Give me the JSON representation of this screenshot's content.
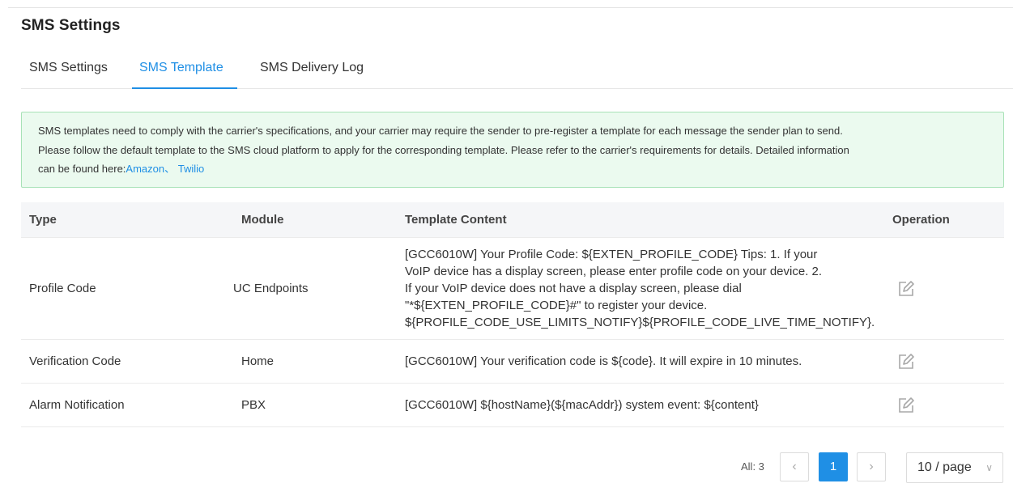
{
  "page": {
    "title": "SMS Settings",
    "tabs": [
      {
        "label": "SMS Settings",
        "active": false
      },
      {
        "label": "SMS Template",
        "active": true
      },
      {
        "label": "SMS Delivery Log",
        "active": false
      }
    ]
  },
  "notice": {
    "line1": "SMS templates need to comply with the carrier's specifications, and your carrier may require the sender to pre-register a template for each message the sender plan to send.",
    "line2": "Please follow the default template to the SMS cloud platform to apply for the corresponding template. Please refer to the carrier's requirements for details. Detailed information",
    "line3_prefix": "can be found here:",
    "link_amazon": "Amazon",
    "separator": "、",
    "link_twilio": "Twilio"
  },
  "table": {
    "headers": {
      "type": "Type",
      "module": "Module",
      "content": "Template Content",
      "operation": "Operation"
    },
    "rows": [
      {
        "type": "Profile Code",
        "module": "UC Endpoints",
        "content_lines": [
          "[GCC6010W] Your Profile Code: ${EXTEN_PROFILE_CODE} Tips: 1. If your",
          "VoIP device has a display screen, please enter profile code on your device. 2.",
          "If your VoIP device does not have a display screen, please dial",
          "\"*${EXTEN_PROFILE_CODE}#\" to register your device.",
          "${PROFILE_CODE_USE_LIMITS_NOTIFY}${PROFILE_CODE_LIVE_TIME_NOTIFY}."
        ],
        "operation_icon": "edit-icon"
      },
      {
        "type": "Verification Code",
        "module": "Home",
        "content": "[GCC6010W] Your verification code is ${code}. It will expire in 10 minutes.",
        "operation_icon": "edit-icon"
      },
      {
        "type": "Alarm Notification",
        "module": "PBX",
        "content": "[GCC6010W] ${hostName}(${macAddr}) system event: ${content}",
        "operation_icon": "edit-icon"
      }
    ]
  },
  "pagination": {
    "total_label": "All: 3",
    "prev_icon": "chevron-left-icon",
    "current_page": "1",
    "next_icon": "chevron-right-icon",
    "page_size": "10 / page",
    "page_size_icon": "chevron-down-icon"
  },
  "colors": {
    "accent": "#1f8fe5",
    "notice_bg": "#ebfaef",
    "notice_border": "#a8e2b7",
    "header_bg": "#f5f6f8"
  }
}
